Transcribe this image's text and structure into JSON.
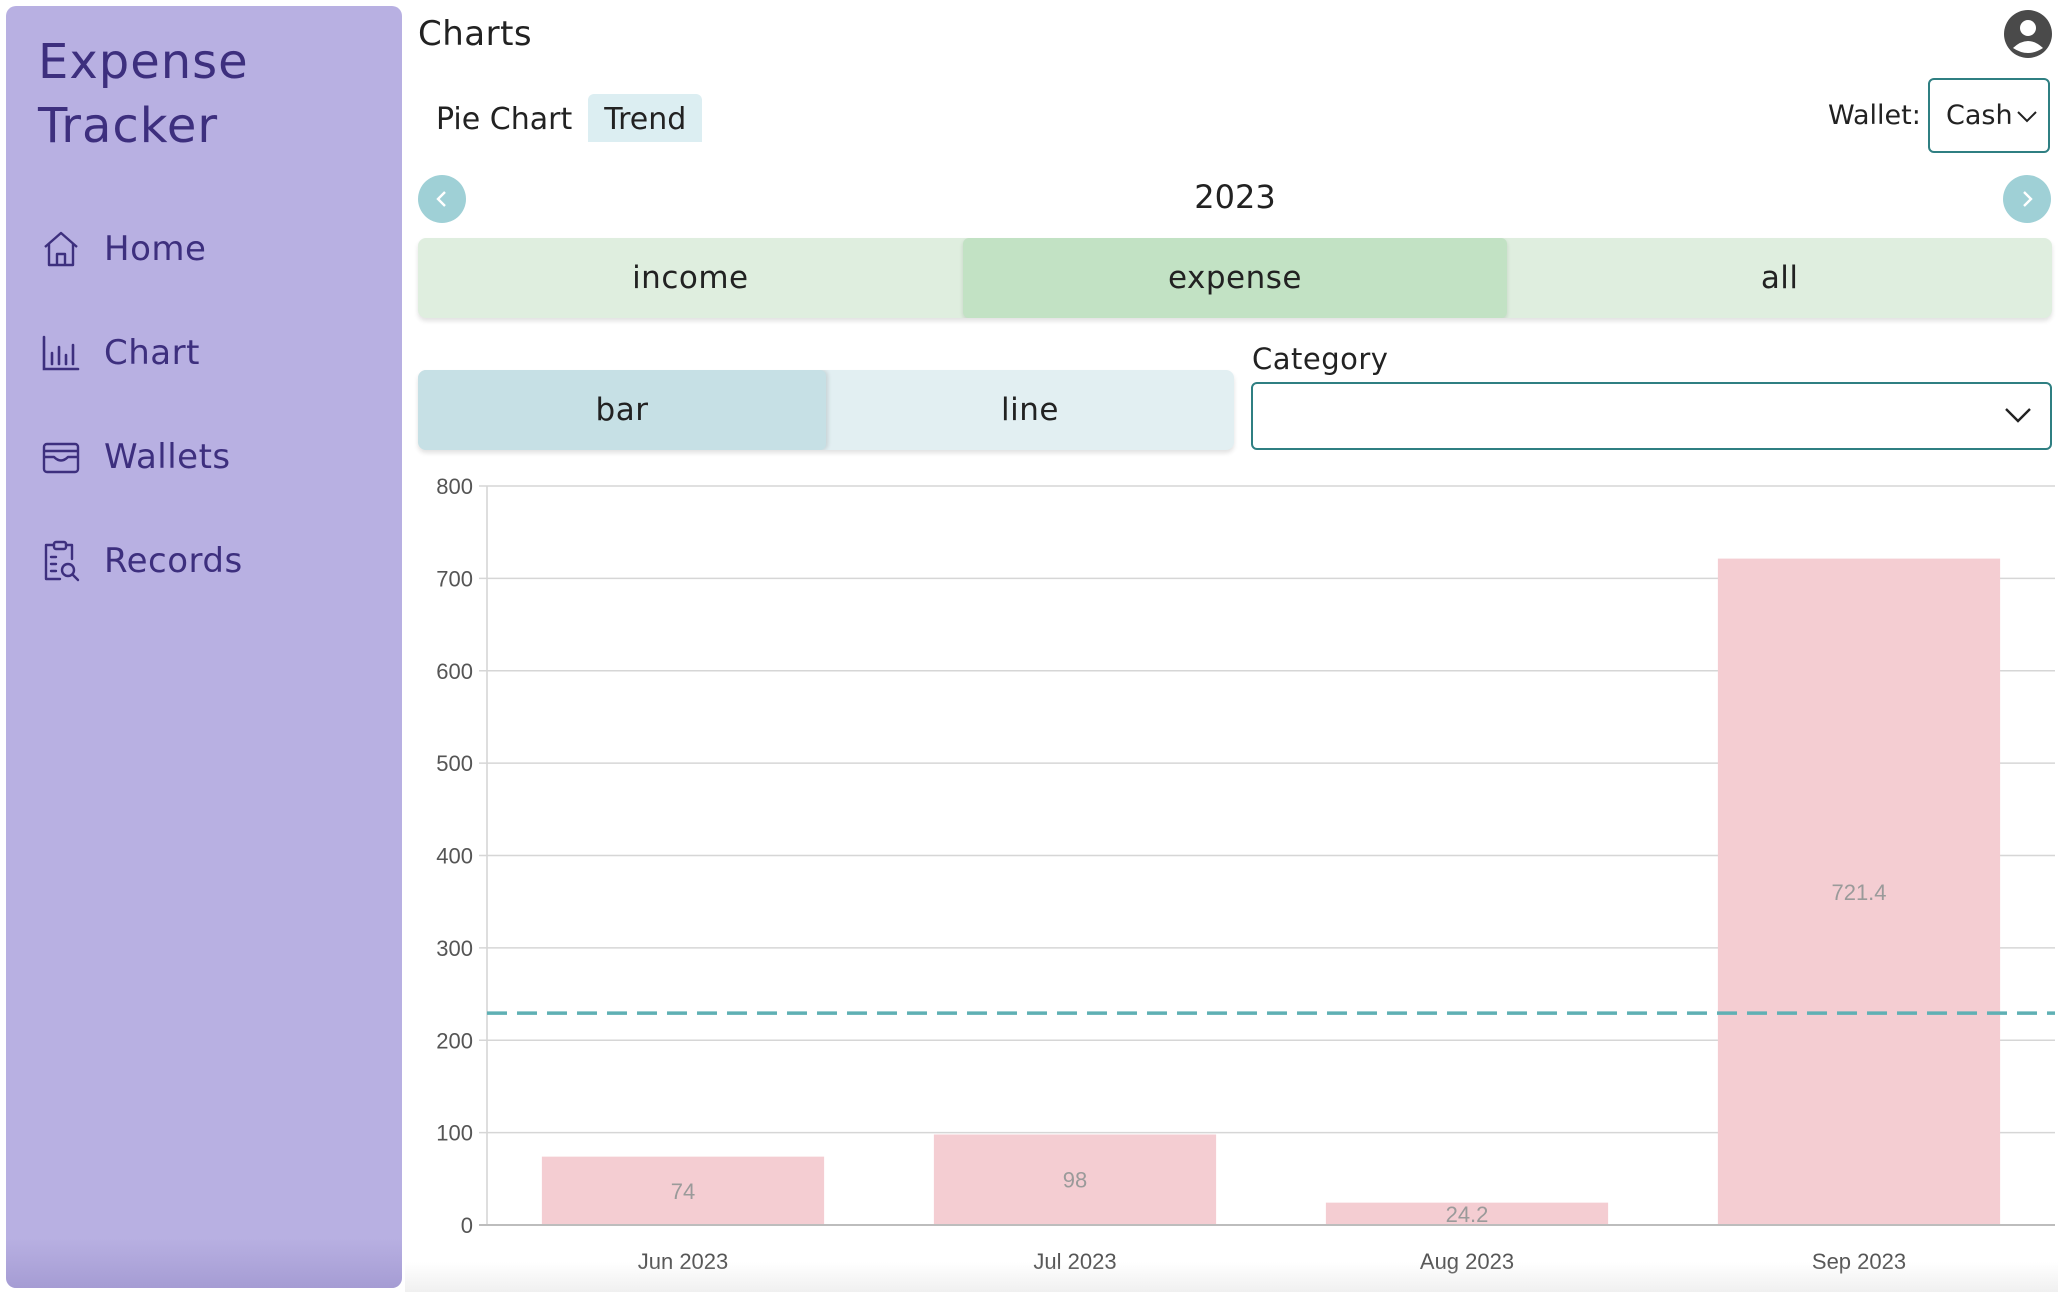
{
  "sidebar": {
    "brand": "Expense Tracker",
    "items": [
      {
        "label": "Home",
        "icon": "home-icon"
      },
      {
        "label": "Chart",
        "icon": "bar-chart-icon"
      },
      {
        "label": "Wallets",
        "icon": "wallet-icon"
      },
      {
        "label": "Records",
        "icon": "records-icon"
      }
    ]
  },
  "header": {
    "title": "Charts",
    "avatar_icon": "user-avatar-icon"
  },
  "view_tabs": [
    {
      "label": "Pie Chart",
      "active": false
    },
    {
      "label": "Trend",
      "active": true
    }
  ],
  "wallet": {
    "label": "Wallet:",
    "selected": "Cash"
  },
  "year_nav": {
    "year": "2023",
    "prev_icon": "chevron-left-icon",
    "next_icon": "chevron-right-icon"
  },
  "type_segments": [
    {
      "label": "income",
      "active": false
    },
    {
      "label": "expense",
      "active": true
    },
    {
      "label": "all",
      "active": false
    }
  ],
  "mode_segments": [
    {
      "label": "bar",
      "active": true
    },
    {
      "label": "line",
      "active": false
    }
  ],
  "category": {
    "label": "Category",
    "selected": ""
  },
  "colors": {
    "sidebar_bg": "#b8b0e2",
    "brand_text": "#3d2f7e",
    "bar_fill": "#f4cdd2",
    "average_line": "#5fb0b4",
    "accent": "#2f7f82"
  },
  "chart_data": {
    "type": "bar",
    "categories": [
      "Jun 2023",
      "Jul 2023",
      "Aug 2023",
      "Sep 2023"
    ],
    "values": [
      74,
      98,
      24.2,
      721.4
    ],
    "value_labels": [
      "74",
      "98",
      "24.2",
      "721.4"
    ],
    "ylim": [
      0,
      800
    ],
    "yticks": [
      0,
      100,
      200,
      300,
      400,
      500,
      600,
      700,
      800
    ],
    "average_line": 229.4,
    "grid": true,
    "title": "",
    "xlabel": "",
    "ylabel": ""
  }
}
